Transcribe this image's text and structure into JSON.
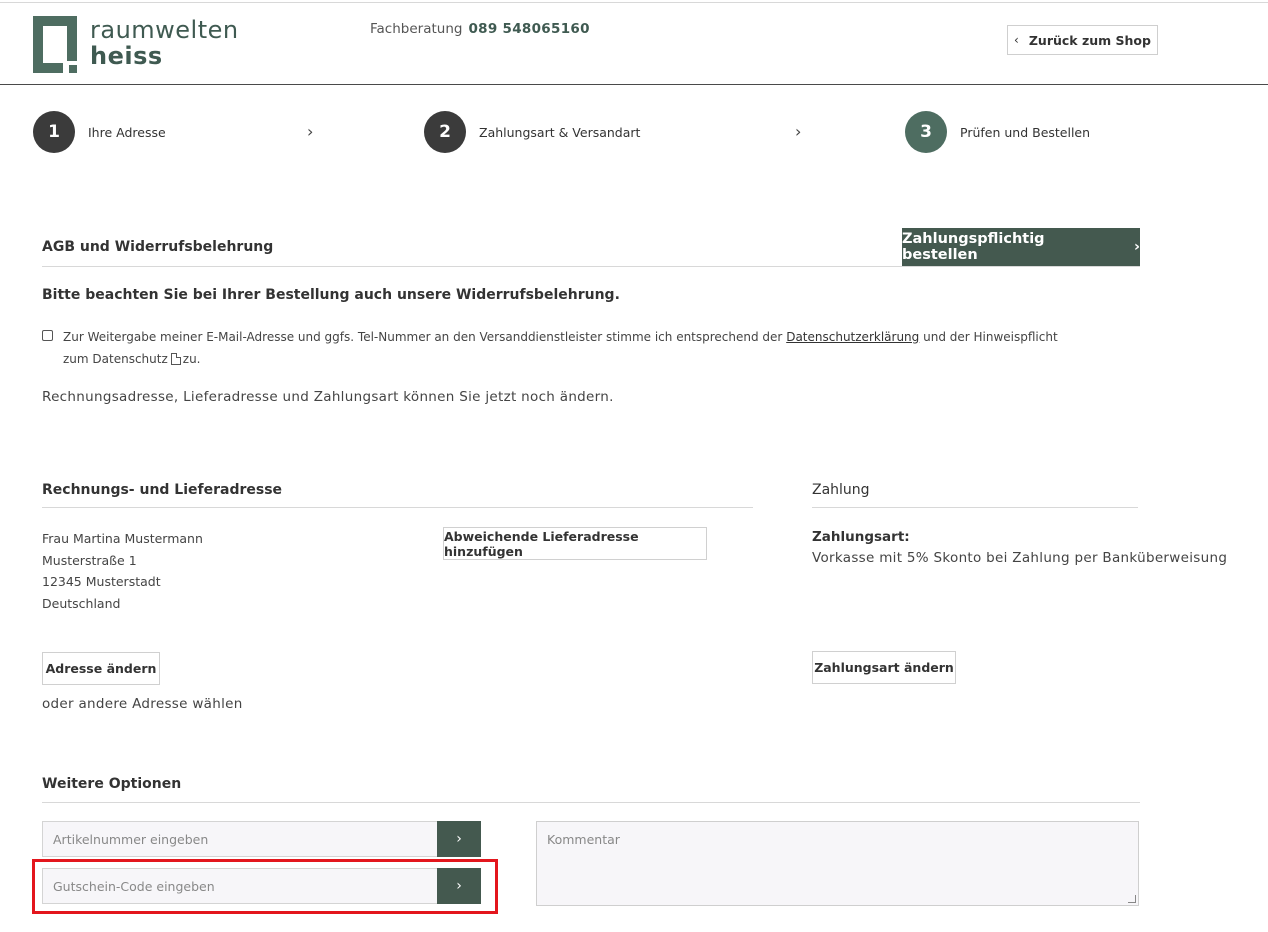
{
  "header": {
    "logo_line1": "raumwelten",
    "logo_line2": "heiss",
    "consult_label": "Fachberatung",
    "consult_phone": "089 548065160",
    "back_label": "Zurück zum Shop"
  },
  "steps": [
    {
      "number": "1",
      "label": "Ihre Adresse"
    },
    {
      "number": "2",
      "label": "Zahlungsart & Versandart"
    },
    {
      "number": "3",
      "label": "Prüfen und Bestellen"
    }
  ],
  "agb": {
    "title": "AGB und Widerrufsbelehrung",
    "order_button": "Zahlungspflichtig bestellen",
    "notice": "Bitte beachten Sie bei Ihrer Bestellung auch unsere Widerrufsbelehrung.",
    "consent_text_1": "Zur Weitergabe meiner E-Mail-Adresse und ggfs. Tel-Nummer an den Versanddienstleister stimme ich entsprechend der",
    "consent_link_1": "Datenschutzerklärung",
    "consent_text_2": "und der Hinweispflicht",
    "consent_text_3": "zum Datenschutz",
    "consent_text_4": "zu.",
    "change_note": "Rechnungsadresse, Lieferadresse und Zahlungsart können Sie jetzt noch ändern."
  },
  "address": {
    "title": "Rechnungs- und Lieferadresse",
    "lines": [
      "Frau Martina Mustermann",
      "Musterstraße 1",
      "12345 Musterstadt",
      "Deutschland"
    ],
    "add_delivery_button": "Abweichende Lieferadresse hinzufügen",
    "change_button": "Adresse ändern",
    "other_address": "oder andere Adresse wählen"
  },
  "payment": {
    "title": "Zahlung",
    "label": "Zahlungsart:",
    "value": "Vorkasse mit 5% Skonto bei Zahlung per Banküberweisung",
    "change_button": "Zahlungsart ändern"
  },
  "options": {
    "title": "Weitere Optionen",
    "article_placeholder": "Artikelnummer eingeben",
    "voucher_placeholder": "Gutschein-Code eingeben",
    "comment_placeholder": "Kommentar"
  },
  "colors": {
    "brand": "#44594f",
    "highlight": "#e3161d"
  }
}
